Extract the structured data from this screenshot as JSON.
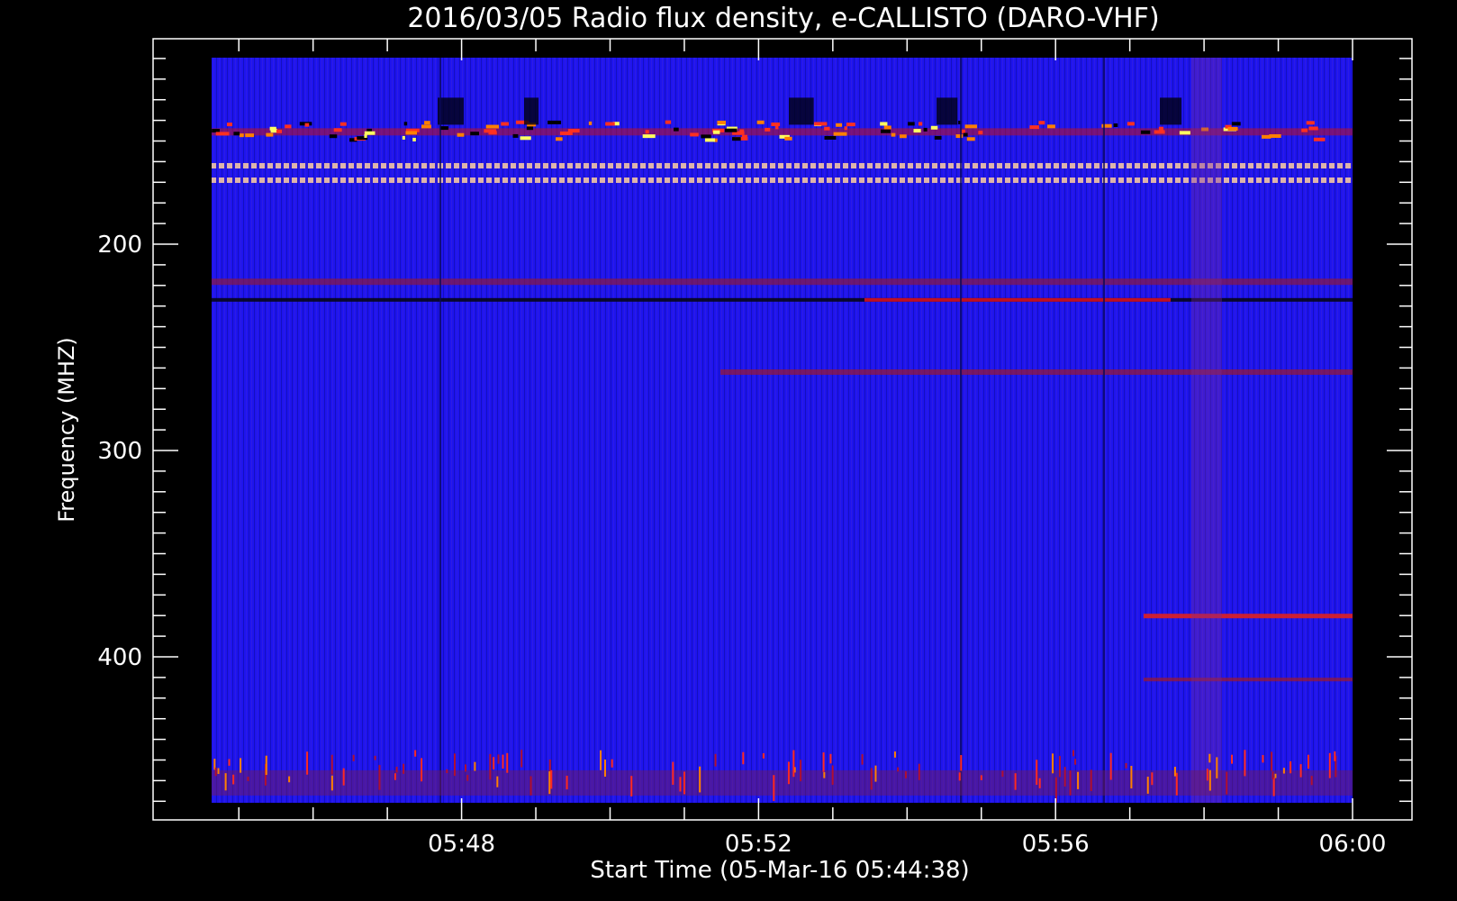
{
  "chart_data": {
    "type": "heatmap",
    "title": "2016/03/05  Radio flux density, e-CALLISTO (DARO-VHF)",
    "xlabel": "Start Time (05-Mar-16 05:44:38)",
    "ylabel": "Frequency (MHZ)",
    "x_start": "05:44:38",
    "x_end": "06:00:00",
    "x_ticks": [
      "05:48",
      "05:52",
      "05:56",
      "06:00"
    ],
    "y_ticks": [
      200,
      300,
      400
    ],
    "y_axis_inverted": true,
    "ylim": [
      110,
      470
    ],
    "data_ylim": [
      119,
      462
    ],
    "colors": {
      "background": "#000000",
      "low": "#1a10f0",
      "mid": "#c01020",
      "high": "#ff8000",
      "max": "#ffff60"
    },
    "features": [
      {
        "description": "bright persistent line",
        "freq_mhz": 146
      },
      {
        "description": "dashed persistent band",
        "freq_mhz": 162
      },
      {
        "description": "dashed persistent band",
        "freq_mhz": 169
      },
      {
        "description": "reddish band",
        "freq_mhz": 218
      },
      {
        "description": "dark/red line",
        "freq_mhz": 227
      },
      {
        "description": "red line",
        "freq_mhz": 262
      },
      {
        "description": "red line",
        "freq_mhz": 380
      },
      {
        "description": "red line",
        "freq_mhz": 411
      }
    ]
  }
}
